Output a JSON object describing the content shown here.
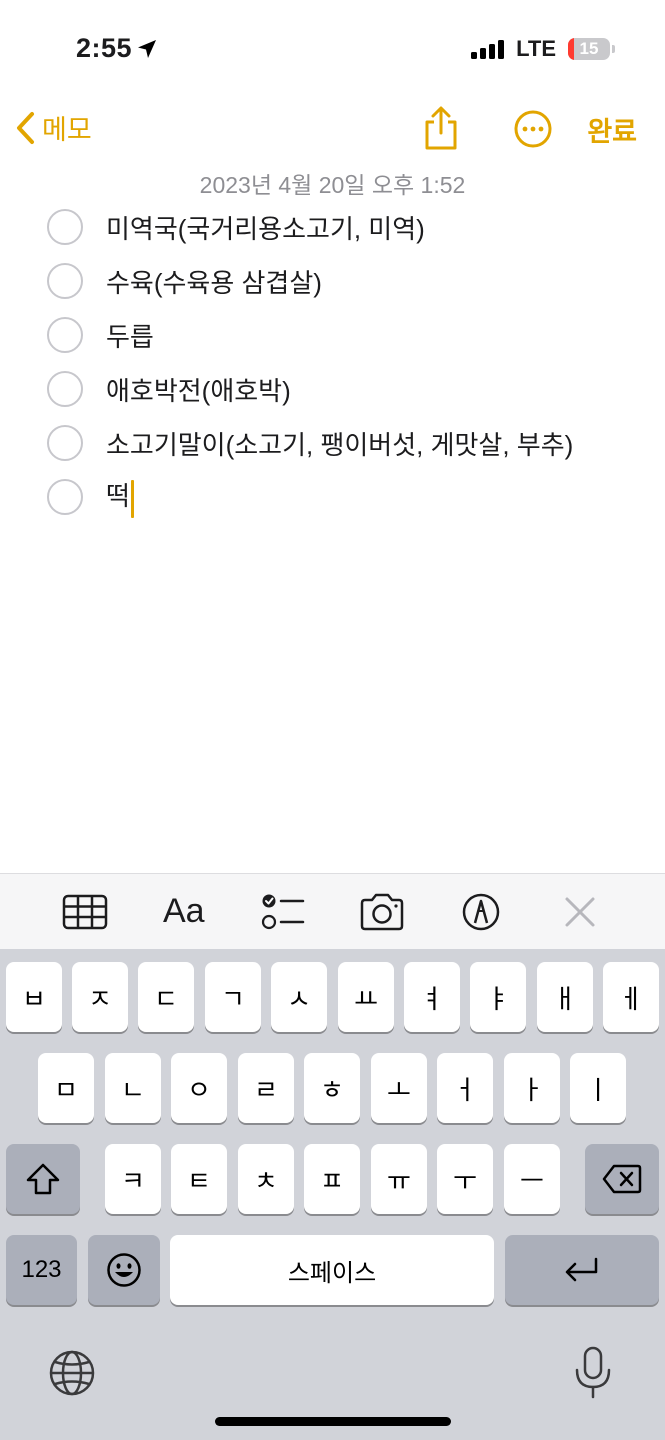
{
  "status": {
    "time": "2:55",
    "network": "LTE",
    "battery": "15",
    "battery_level_percent": 15,
    "signal_bars_filled": 4
  },
  "nav": {
    "back_label": "메모",
    "done_label": "완료"
  },
  "note": {
    "date": "2023년 4월 20일 오후 1:52",
    "items": [
      {
        "text": "미역국(국거리용소고기, 미역)",
        "checked": false
      },
      {
        "text": "수육(수육용 삼겹살)",
        "checked": false
      },
      {
        "text": "두릅",
        "checked": false
      },
      {
        "text": "애호박전(애호박)",
        "checked": false
      },
      {
        "text": "소고기말이(소고기, 팽이버섯, 게맛살, 부추)",
        "checked": false
      },
      {
        "text": "떡",
        "checked": false
      }
    ]
  },
  "toolbar": {
    "format_label": "Aa"
  },
  "keyboard": {
    "row1": [
      "ㅂ",
      "ㅈ",
      "ㄷ",
      "ㄱ",
      "ㅅ",
      "ㅛ",
      "ㅕ",
      "ㅑ",
      "ㅐ",
      "ㅔ"
    ],
    "row2": [
      "ㅁ",
      "ㄴ",
      "ㅇ",
      "ㄹ",
      "ㅎ",
      "ㅗ",
      "ㅓ",
      "ㅏ",
      "ㅣ"
    ],
    "row3": [
      "ㅋ",
      "ㅌ",
      "ㅊ",
      "ㅍ",
      "ㅠ",
      "ㅜ",
      "ㅡ"
    ],
    "numbers_label": "123",
    "space_label": "스페이스"
  },
  "colors": {
    "accent": "#e2a500",
    "keyboard_bg": "#d1d3d9",
    "dark_key": "#abafba",
    "checkbox_border": "#c7c7cc",
    "battery_low": "#ff3b30"
  }
}
